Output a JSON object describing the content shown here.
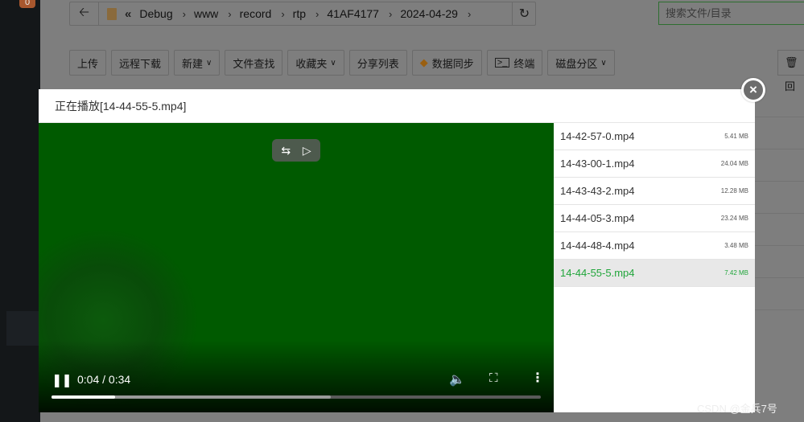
{
  "sidebar": {
    "badge": "0"
  },
  "pathbar": {
    "back_icon": "arrow-left-icon",
    "crumbs": [
      "Debug",
      "www",
      "record",
      "rtp",
      "41AF4177",
      "2024-04-29"
    ]
  },
  "search": {
    "placeholder": "搜索文件/目录"
  },
  "toolbar": {
    "upload": "上传",
    "remote_download": "远程下载",
    "new": "新建",
    "file_search": "文件查找",
    "favorites": "收藏夹",
    "share_list": "分享列表",
    "data_sync": "数据同步",
    "terminal": "终端",
    "disk_partition": "磁盘分区",
    "trash": "回"
  },
  "modal": {
    "title": "正在播放[14-44-55-5.mp4]",
    "close_icon": "close-icon"
  },
  "player": {
    "time": "0:04 / 0:34",
    "progress": 0.13,
    "buffered": 0.57,
    "background_color": "#005a00"
  },
  "playlist": [
    {
      "name": "14-42-57-0.mp4",
      "size": "5.41 MB",
      "active": false
    },
    {
      "name": "14-43-00-1.mp4",
      "size": "24.04 MB",
      "active": false
    },
    {
      "name": "14-43-43-2.mp4",
      "size": "12.28 MB",
      "active": false
    },
    {
      "name": "14-44-05-3.mp4",
      "size": "23.24 MB",
      "active": false
    },
    {
      "name": "14-44-48-4.mp4",
      "size": "3.48 MB",
      "active": false
    },
    {
      "name": "14-44-55-5.mp4",
      "size": "7.42 MB",
      "active": true
    }
  ],
  "accent_color": "#20a53a",
  "watermark": "CSDN @金兵7号"
}
